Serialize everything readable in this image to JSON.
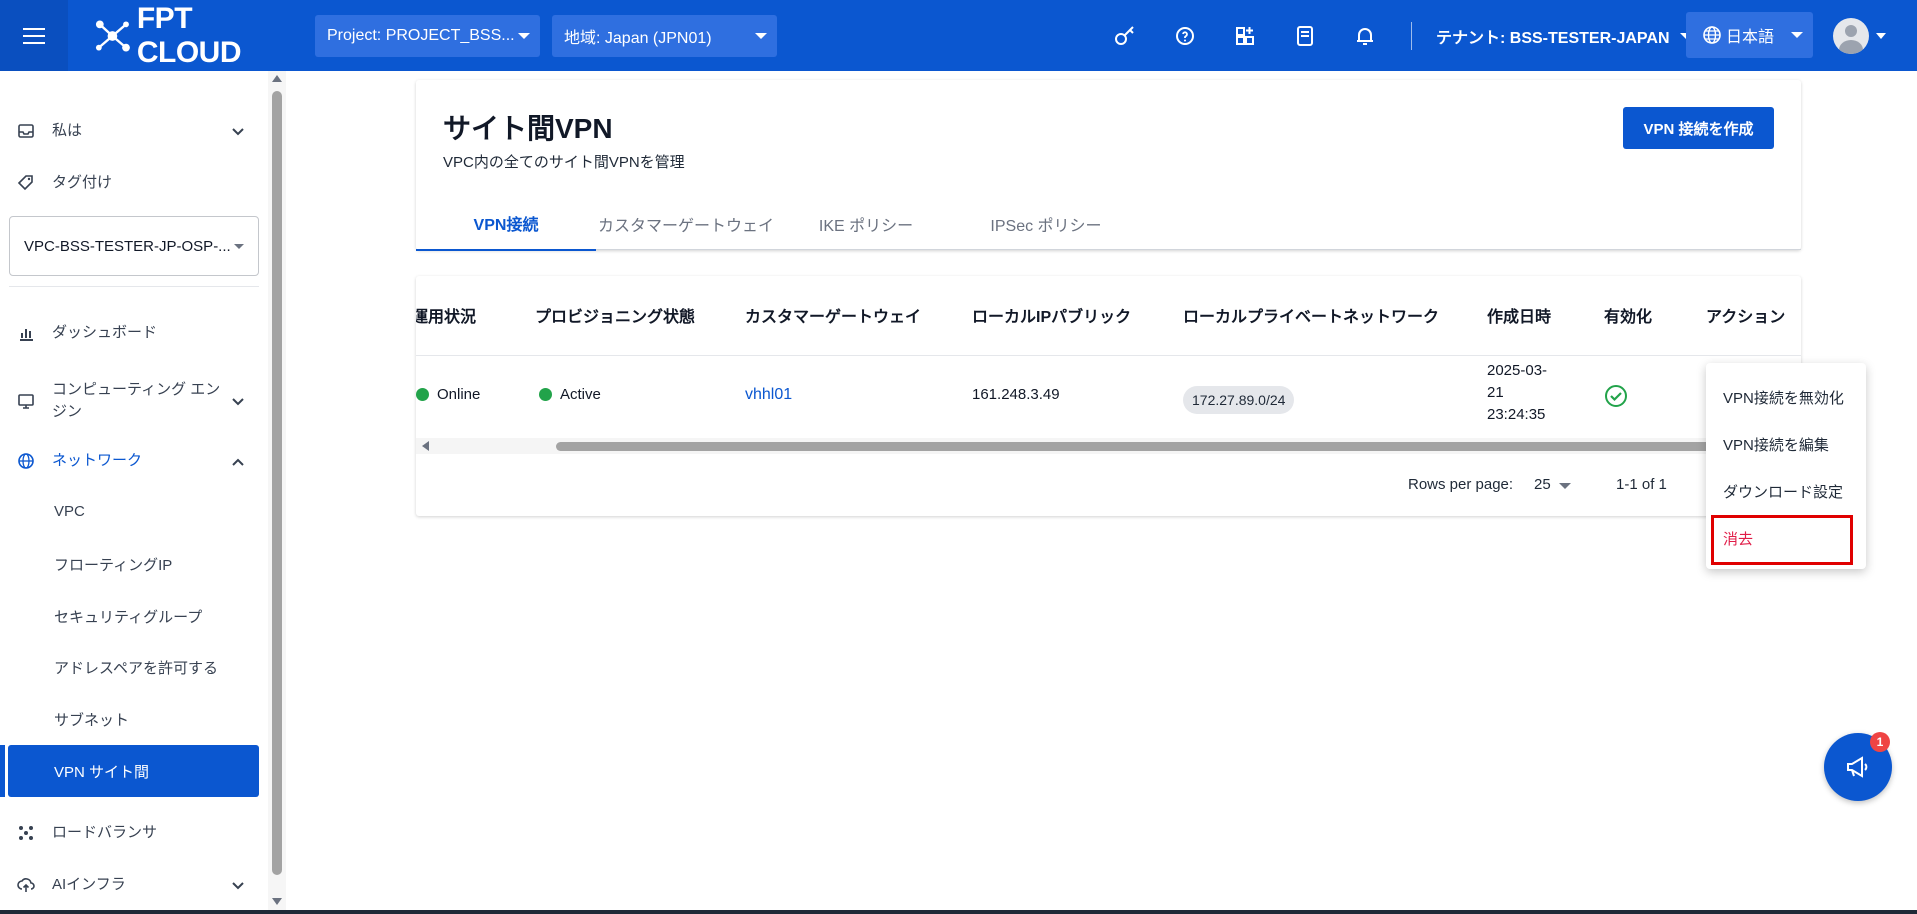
{
  "header": {
    "brand": "FPT CLOUD",
    "project": "Project: PROJECT_BSS...",
    "region": "地域: Japan (JPN01)",
    "tenant": "テナント: BSS-TESTER-JAPAN",
    "language": "日本語"
  },
  "sidebar": {
    "me": "私は",
    "tags": "タグ付け",
    "vpc_select": "VPC-BSS-TESTER-JP-OSP-...",
    "dashboard": "ダッシュボード",
    "computing": "コンピューティング エンジン",
    "network": "ネットワーク",
    "sub_items": [
      "VPC",
      "フローティングIP",
      "セキュリティグループ",
      "アドレスペアを許可する",
      "サブネット",
      "VPN サイト間"
    ],
    "load_balancer": "ロードバランサ",
    "ai_infra": "AIインフラ"
  },
  "page": {
    "title": "サイト間VPN",
    "subtitle": "VPC内の全てのサイト間VPNを管理",
    "create_button": "VPN 接続を作成",
    "tabs": [
      "VPN接続",
      "カスタマーゲートウェイ",
      "IKE ポリシー",
      "IPSec ポリシー"
    ]
  },
  "table": {
    "headers": [
      "運用状況",
      "プロビジョニング状態",
      "カスタマーゲートウェイ",
      "ローカルIPパブリック",
      "ローカルプライベートネットワーク",
      "作成日時",
      "有効化",
      "アクション"
    ],
    "rows": [
      {
        "status": "Online",
        "provisioning": "Active",
        "gateway": "vhhl01",
        "local_ip": "161.248.3.49",
        "private_network": "172.27.89.0/24",
        "created_line1": "2025-03-",
        "created_line2": "21",
        "created_line3": "23:24:35",
        "enabled": true
      }
    ],
    "rows_per_page_label": "Rows per page:",
    "rows_per_page": "25",
    "range": "1-1 of 1"
  },
  "action_menu": [
    "VPN接続を無効化",
    "VPN接続を編集",
    "ダウンロード設定",
    "消去"
  ],
  "fab": {
    "badge": "1"
  },
  "colors": {
    "primary": "#0b57d0",
    "success": "#22a34a",
    "danger": "#e11d48"
  }
}
